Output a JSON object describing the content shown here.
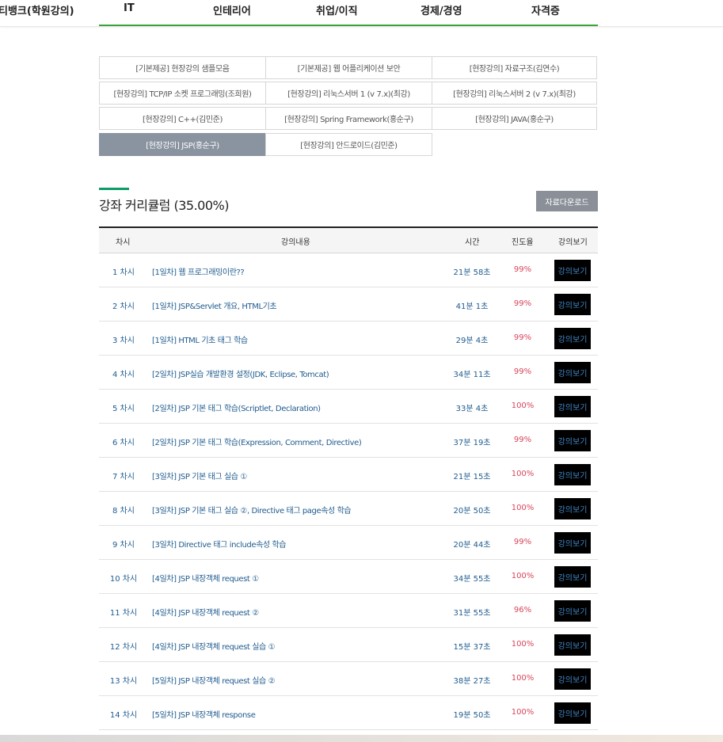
{
  "nav": {
    "items": [
      "티뱅크(학원강의)",
      "IT",
      "인테리어",
      "취업/이직",
      "경제/경영",
      "자격증"
    ]
  },
  "categories": [
    "[기본제공] 현장강의 샘플모음",
    "[기본제공] 웹 어플리케이션 보안",
    "[현장강의] 자료구조(김연수)",
    "[현장강의] TCP/IP 소켓 프로그래밍(조희원)",
    "[현장강의] 리눅스서버 1 (v 7.x)(최강)",
    "[현장강의] 리눅스서버 2 (v 7.x)(최강)",
    "[현장강의] C++(김민준)",
    "[현장강의] Spring Framework(홍순구)",
    "[현장강의] JAVA(홍순구)",
    "[현장강의] JSP(홍순구)",
    "[현장강의] 안드로이드(김민준)"
  ],
  "active_category_index": 9,
  "curriculum": {
    "title": "강좌 커리큘럼 (35.00%)",
    "download_label": "자료다운로드"
  },
  "table": {
    "headers": [
      "차시",
      "강의내용",
      "시간",
      "진도율",
      "강의보기"
    ],
    "rows": [
      {
        "num": "1 차시",
        "title": "[1일차] 웹 프로그래밍이란??",
        "time": "21분 58초",
        "pct": "99%",
        "btn": "강의보기"
      },
      {
        "num": "2 차시",
        "title": "[1일차] JSP&Servlet 개요, HTML기초",
        "time": "41분 1초",
        "pct": "99%",
        "btn": "강의보기"
      },
      {
        "num": "3 차시",
        "title": "[1일차] HTML 기초 태그 학습",
        "time": "29분 4초",
        "pct": "99%",
        "btn": "강의보기"
      },
      {
        "num": "4 차시",
        "title": "[2일차] JSP실습 개발환경 설정(JDK, Eclipse, Tomcat)",
        "time": "34분 11초",
        "pct": "99%",
        "btn": "강의보기"
      },
      {
        "num": "5 차시",
        "title": "[2일차] JSP 기본 태그 학습(Scriptlet, Declaration)",
        "time": "33분 4초",
        "pct": "100%",
        "btn": "강의보기"
      },
      {
        "num": "6 차시",
        "title": "[2일차] JSP 기본 태그 학습(Expression, Comment, Directive)",
        "time": "37분 19초",
        "pct": "99%",
        "btn": "강의보기"
      },
      {
        "num": "7 차시",
        "title": "[3일차] JSP 기본 태그 실습 ①",
        "time": "21분 15초",
        "pct": "100%",
        "btn": "강의보기"
      },
      {
        "num": "8 차시",
        "title": "[3일차] JSP 기본 태그 실습 ②, Directive 태그 page속성 학습",
        "time": "20분 50초",
        "pct": "100%",
        "btn": "강의보기"
      },
      {
        "num": "9 차시",
        "title": "[3일차] Directive 태그 include속성 학습",
        "time": "20분 44초",
        "pct": "99%",
        "btn": "강의보기"
      },
      {
        "num": "10 차시",
        "title": "[4일차] JSP 내장객체 request ①",
        "time": "34분 55초",
        "pct": "100%",
        "btn": "강의보기"
      },
      {
        "num": "11 차시",
        "title": "[4일차] JSP 내장객체 request ②",
        "time": "31분 55초",
        "pct": "96%",
        "btn": "강의보기"
      },
      {
        "num": "12 차시",
        "title": "[4일차] JSP 내장객체 request 실습 ①",
        "time": "15분 37초",
        "pct": "100%",
        "btn": "강의보기"
      },
      {
        "num": "13 차시",
        "title": "[5일차] JSP 내장객체 request 실습 ②",
        "time": "38분 27초",
        "pct": "100%",
        "btn": "강의보기"
      },
      {
        "num": "14 차시",
        "title": "[5일차] JSP 내장객체 response",
        "time": "19분 50초",
        "pct": "100%",
        "btn": "강의보기"
      }
    ]
  },
  "colors": {
    "nav_underline": "#3aa33a",
    "section_mark": "#0e9b6a",
    "active_category_bg": "#8a93a0",
    "link_text": "#1f5b8f",
    "progress_text": "#d8455a",
    "view_button_bg": "#000000"
  }
}
